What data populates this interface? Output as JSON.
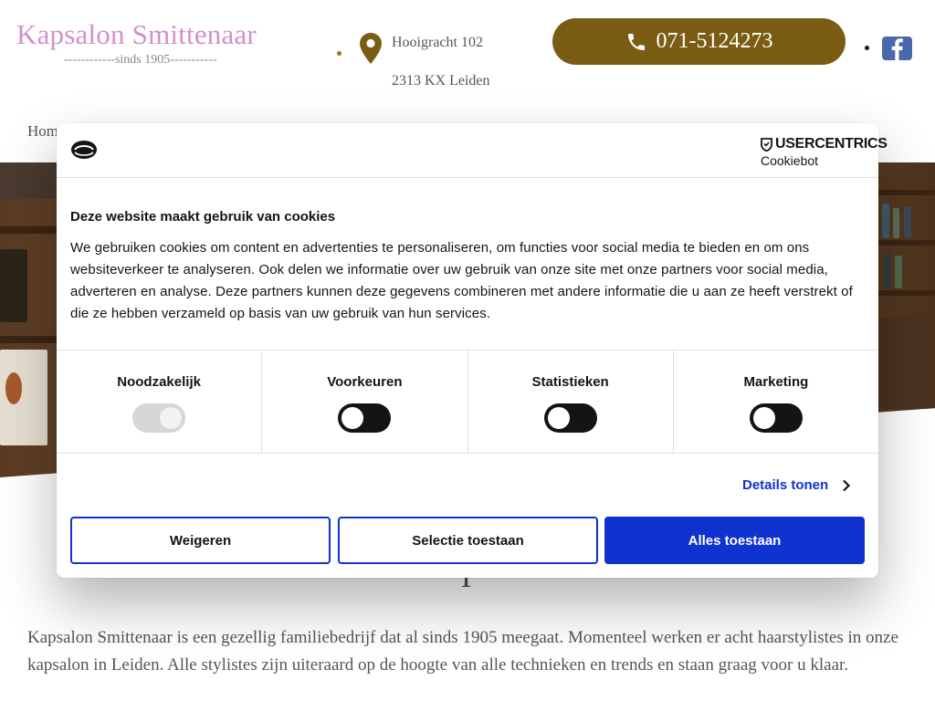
{
  "header": {
    "logo_title": "Kapsalon Smittenaar",
    "logo_subtitle": "------------sinds 1905-----------",
    "address_line1": "Hooigracht 102",
    "address_line2": "2313 KX Leiden",
    "phone": "071-5124273",
    "brand_color": "#7b5c13",
    "logo_color": "#d48fcb"
  },
  "nav": {
    "home": "Hom"
  },
  "page": {
    "hero_title_partial": "l",
    "intro": "Kapsalon Smittenaar is een gezellig familiebedrijf dat al sinds 1905 meegaat. Momenteel werken er acht haarstylistes in onze kapsalon in Leiden. Alle stylistes zijn uiteraard op de hoogte van alle technieken en trends en staan graag voor u klaar."
  },
  "cookie_banner": {
    "brand_name": "USERCENTRICS",
    "brand_sub": "Cookiebot",
    "heading": "Deze website maakt gebruik van cookies",
    "body": "We gebruiken cookies om content en advertenties te personaliseren, om functies voor social media te bieden en om ons websiteverkeer te analyseren. Ook delen we informatie over uw gebruik van onze site met onze partners voor social media, adverteren en analyse. Deze partners kunnen deze gegevens combineren met andere informatie die u aan ze heeft verstrekt of die ze hebben verzameld op basis van uw gebruik van hun services.",
    "toggles": [
      {
        "label": "Noodzakelijk",
        "enabled": true,
        "disabled": true
      },
      {
        "label": "Voorkeuren",
        "enabled": false,
        "disabled": false
      },
      {
        "label": "Statistieken",
        "enabled": false,
        "disabled": false
      },
      {
        "label": "Marketing",
        "enabled": false,
        "disabled": false
      }
    ],
    "details_label": "Details tonen",
    "buttons": {
      "reject": "Weigeren",
      "allow_selection": "Selectie toestaan",
      "allow_all": "Alles toestaan"
    },
    "accent_color": "#1032cf"
  }
}
